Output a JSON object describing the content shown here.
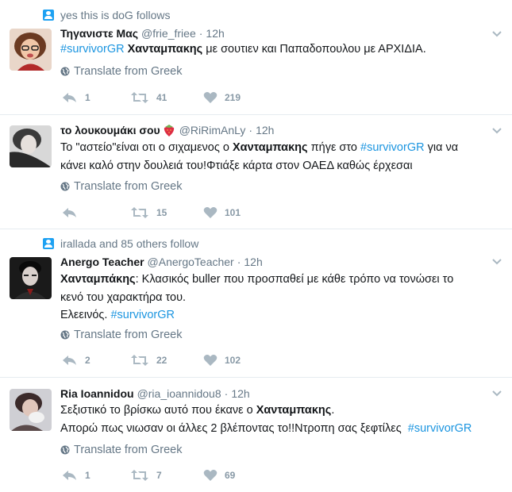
{
  "colors": {
    "accent": "#1da1f2",
    "hashtag": "#1b95e0",
    "muted": "#657786",
    "action": "#aab8c2"
  },
  "tweets": [
    {
      "context": "yes this is doG follows",
      "name": "Τηγανιστε Μας",
      "handle": "@frie_friee",
      "dot": "·",
      "time": "12h",
      "lines": [
        [
          {
            "t": "#survivorGR",
            "s": "tag"
          },
          {
            "t": " ",
            "s": "n"
          },
          {
            "t": "Χανταμπακης",
            "s": "b"
          },
          {
            "t": " με σουτιεν και Παπαδοπουλου με ΑΡΧΙΔΙΑ.",
            "s": "n"
          }
        ]
      ],
      "translate": "Translate from Greek",
      "replies": "1",
      "retweets": "41",
      "likes": "219"
    },
    {
      "context": "",
      "name": "το λουκουμάκι σου",
      "name_emoji": "strawberry-emoji",
      "handle": "@RiRimAnLy",
      "dot": "·",
      "time": "12h",
      "lines": [
        [
          {
            "t": "Το \"αστείο\"είναι οτι ο σιχαμενος ο ",
            "s": "n"
          },
          {
            "t": "Χανταμπακης",
            "s": "b"
          },
          {
            "t": " πήγε στο ",
            "s": "n"
          },
          {
            "t": "#survivorGR",
            "s": "tag"
          },
          {
            "t": " για να",
            "s": "n"
          }
        ],
        [
          {
            "t": "κάνει καλό στην δουλειά του!Φτιάξε κάρτα στον ΟΑΕΔ καθώς έρχεσαι",
            "s": "n"
          }
        ]
      ],
      "translate": "Translate from Greek",
      "replies": "",
      "retweets": "15",
      "likes": "101"
    },
    {
      "context": "irallada and 85 others follow",
      "name": "Anergo Teacher",
      "handle": "@AnergoTeacher",
      "dot": "·",
      "time": "12h",
      "lines": [
        [
          {
            "t": "Χανταμπάκης",
            "s": "b"
          },
          {
            "t": ": Κλασικός buller που προσπαθεί με κάθε τρόπο να τονώσει το",
            "s": "n"
          }
        ],
        [
          {
            "t": "κενό του χαρακτήρα του.",
            "s": "n"
          }
        ],
        [
          {
            "t": "Ελεεινός. ",
            "s": "n"
          },
          {
            "t": "#survivorGR",
            "s": "tag"
          }
        ]
      ],
      "translate": "Translate from Greek",
      "replies": "2",
      "retweets": "22",
      "likes": "102"
    },
    {
      "context": "",
      "name": "Ria Ioannidou",
      "handle": "@ria_ioannidou8",
      "dot": "·",
      "time": "12h",
      "lines": [
        [
          {
            "t": "Σεξιστικό το βρίσκω αυτό που έκανε ο ",
            "s": "n"
          },
          {
            "t": "Χανταμπακης",
            "s": "b"
          },
          {
            "t": ".",
            "s": "n"
          }
        ],
        [
          {
            "t": "Απορώ πως νιωσαν οι άλλες 2 βλέποντας το!!Ντροπη σας ξεφτίλες  ",
            "s": "n"
          },
          {
            "t": "#survivorGR",
            "s": "tag"
          }
        ]
      ],
      "translate": "Translate from Greek",
      "replies": "1",
      "retweets": "7",
      "likes": "69"
    }
  ]
}
